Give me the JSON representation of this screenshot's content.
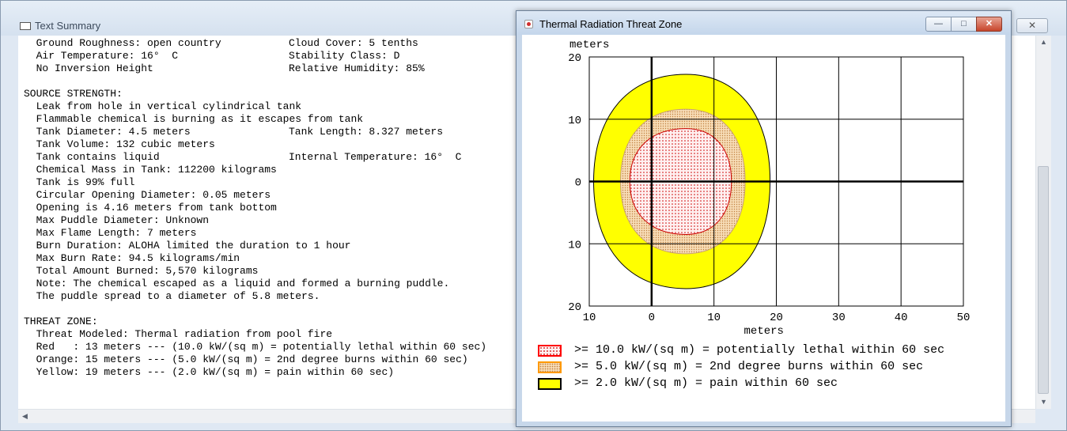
{
  "summary_window": {
    "title": "Text Summary",
    "lines": [
      [
        "  Ground Roughness: open country",
        "Cloud Cover: 5 tenths"
      ],
      [
        "  Air Temperature: 16°  C",
        "Stability Class: D"
      ],
      [
        "  No Inversion Height",
        "Relative Humidity: 85%"
      ],
      [
        "",
        ""
      ],
      [
        "SOURCE STRENGTH:",
        ""
      ],
      [
        "  Leak from hole in vertical cylindrical tank",
        ""
      ],
      [
        "  Flammable chemical is burning as it escapes from tank",
        ""
      ],
      [
        "  Tank Diameter: 4.5 meters",
        "Tank Length: 8.327 meters"
      ],
      [
        "  Tank Volume: 132 cubic meters",
        ""
      ],
      [
        "  Tank contains liquid",
        "Internal Temperature: 16°  C"
      ],
      [
        "  Chemical Mass in Tank: 112200 kilograms",
        ""
      ],
      [
        "  Tank is 99% full",
        ""
      ],
      [
        "  Circular Opening Diameter: 0.05 meters",
        ""
      ],
      [
        "  Opening is 4.16 meters from tank bottom",
        ""
      ],
      [
        "  Max Puddle Diameter: Unknown",
        ""
      ],
      [
        "  Max Flame Length: 7 meters",
        ""
      ],
      [
        "  Burn Duration: ALOHA limited the duration to 1 hour",
        ""
      ],
      [
        "  Max Burn Rate: 94.5 kilograms/min",
        ""
      ],
      [
        "  Total Amount Burned: 5,570 kilograms",
        ""
      ],
      [
        "  Note: The chemical escaped as a liquid and formed a burning puddle.",
        ""
      ],
      [
        "  The puddle spread to a diameter of 5.8 meters.",
        ""
      ],
      [
        "",
        ""
      ],
      [
        "THREAT ZONE:",
        ""
      ],
      [
        "  Threat Modeled: Thermal radiation from pool fire",
        ""
      ],
      [
        "  Red   : 13 meters --- (10.0 kW/(sq m) = potentially lethal within 60 sec)",
        ""
      ],
      [
        "  Orange: 15 meters --- (5.0 kW/(sq m) = 2nd degree burns within 60 sec)",
        ""
      ],
      [
        "  Yellow: 19 meters --- (2.0 kW/(sq m) = pain within 60 sec)",
        ""
      ]
    ]
  },
  "plot_window": {
    "title": "Thermal Radiation Threat Zone",
    "buttons": {
      "minimize": "—",
      "maximize": "□",
      "close": "✕"
    },
    "icons": {
      "window": "alert-icon"
    }
  },
  "chart_data": {
    "type": "threat-zone",
    "x_label": "meters",
    "y_label": "meters",
    "x_ticks": [
      "10",
      "0",
      "10",
      "20",
      "30",
      "40",
      "50"
    ],
    "x_tick_values": [
      -10,
      0,
      10,
      20,
      30,
      40,
      50
    ],
    "y_ticks": [
      "20",
      "10",
      "0",
      "10",
      "20"
    ],
    "y_tick_values": [
      20,
      10,
      0,
      -10,
      -20
    ],
    "xlim": [
      -10,
      50
    ],
    "ylim": [
      -20,
      20
    ],
    "grid": true,
    "zones": [
      {
        "color": "#ffff00",
        "pattern": "solid",
        "xmin": -9.3,
        "xmax": 19,
        "ymax": 17.2,
        "ymin": -17.2,
        "cx": 5.5,
        "cy": 0
      },
      {
        "color": "#f0c89a",
        "pattern": "orange-dots",
        "xmin": -5,
        "xmax": 15,
        "ymax": 11.6,
        "ymin": -11.6,
        "cx": 5.5,
        "cy": 0
      },
      {
        "color": "#cc0000",
        "pattern": "red-dots",
        "xmin": -3.5,
        "xmax": 12.8,
        "ymax": 8.5,
        "ymin": -8.5,
        "cx": 5.5,
        "cy": 0
      }
    ],
    "legend": [
      {
        "label": ">= 10.0 kW/(sq m) = potentially lethal within 60 sec",
        "border": "#ff0000",
        "fill": "red-dots"
      },
      {
        "label": ">= 5.0 kW/(sq m) = 2nd degree burns within 60 sec",
        "border": "#ff9900",
        "fill": "orange-dots"
      },
      {
        "label": ">= 2.0 kW/(sq m) = pain within 60 sec",
        "border": "#000000",
        "fill": "#ffff00"
      }
    ]
  }
}
